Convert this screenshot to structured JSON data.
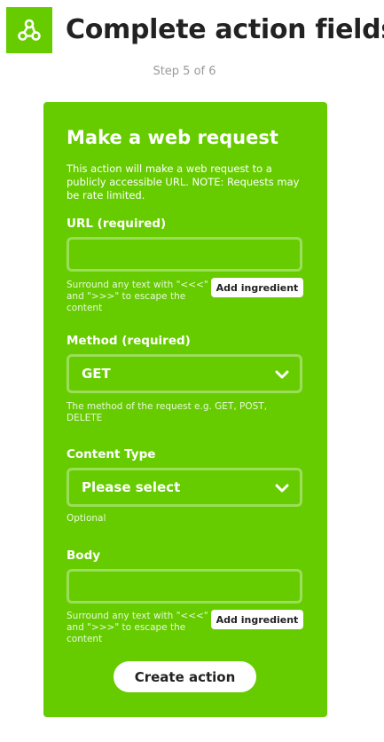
{
  "header": {
    "title": "Complete action fields",
    "step": "Step 5 of 6",
    "logo_icon": "webhooks-icon",
    "logo_color": "#66cc00"
  },
  "card": {
    "title": "Make a web request",
    "description": "This action will make a web request to a publicly accessible URL. NOTE: Requests may be rate limited.",
    "background_color": "#66cc00",
    "fields": {
      "url": {
        "label": "URL (required)",
        "value": "",
        "helper": "Surround any text with \"<<<\" and \">>>\" to escape the content",
        "add_ingredient_label": "Add ingredient"
      },
      "method": {
        "label": "Method (required)",
        "selected": "GET",
        "helper": "The method of the request e.g. GET, POST, DELETE"
      },
      "content_type": {
        "label": "Content Type",
        "selected": "Please select",
        "helper": "Optional"
      },
      "body": {
        "label": "Body",
        "value": "",
        "helper": "Surround any text with \"<<<\" and \">>>\" to escape the content",
        "add_ingredient_label": "Add ingredient"
      }
    },
    "submit_label": "Create action"
  }
}
